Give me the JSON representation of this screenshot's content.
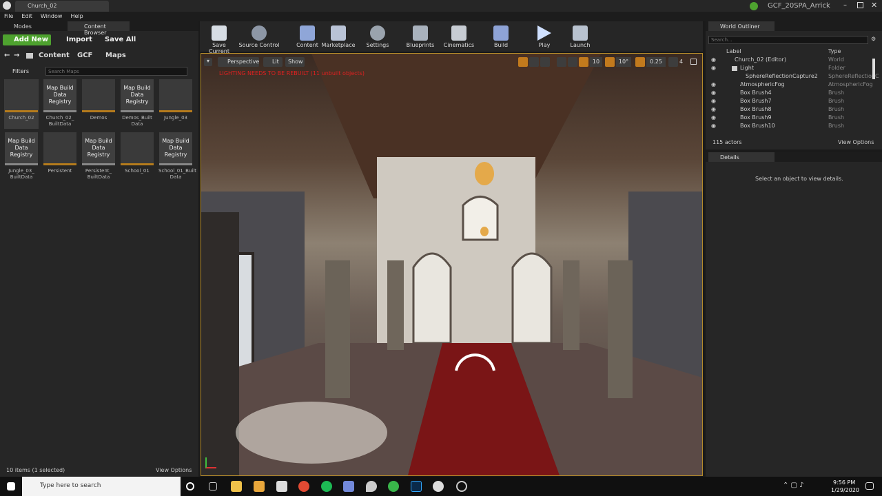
{
  "window": {
    "doc_tab": "Church_02",
    "project": "GCF_20SPA_Arrick"
  },
  "menu": [
    "File",
    "Edit",
    "Window",
    "Help"
  ],
  "left_tabs": {
    "modes": "Modes",
    "content_browser": "Content Browser"
  },
  "cb_toolbar": {
    "add_new": "Add New",
    "import": "Import",
    "save_all": "Save All"
  },
  "breadcrumb": [
    "Content",
    "GCF",
    "Maps"
  ],
  "filters": {
    "label": "Filters",
    "search_placeholder": "Search Maps"
  },
  "assets": [
    {
      "name": "Church_02",
      "kind": "map"
    },
    {
      "name": "Church_02_ BuiltData",
      "kind": "registry"
    },
    {
      "name": "Demos",
      "kind": "map"
    },
    {
      "name": "Demos_Built Data",
      "kind": "registry"
    },
    {
      "name": "Jungle_03",
      "kind": "map"
    },
    {
      "name": "Jungle_03_ BuiltData",
      "kind": "registry"
    },
    {
      "name": "Persistent",
      "kind": "map"
    },
    {
      "name": "Persistent_ BuiltData",
      "kind": "registry"
    },
    {
      "name": "School_01",
      "kind": "map"
    },
    {
      "name": "School_01_Built Data",
      "kind": "registry"
    }
  ],
  "registry_label": "Map Build Data Registry",
  "cb_status": {
    "count": "10 items (1 selected)",
    "view_options": "View Options"
  },
  "toolbar": [
    {
      "label": "Save Current",
      "icon": "save-icon"
    },
    {
      "label": "Source Control",
      "icon": "source-control-icon"
    },
    {
      "label": "Content",
      "icon": "content-icon"
    },
    {
      "label": "Marketplace",
      "icon": "marketplace-icon"
    },
    {
      "label": "Settings",
      "icon": "settings-icon"
    },
    {
      "label": "Blueprints",
      "icon": "blueprints-icon"
    },
    {
      "label": "Cinematics",
      "icon": "cinematics-icon"
    },
    {
      "label": "Build",
      "icon": "build-icon"
    },
    {
      "label": "Play",
      "icon": "play-icon"
    },
    {
      "label": "Launch",
      "icon": "launch-icon"
    }
  ],
  "viewport": {
    "perspective": "Perspective",
    "lit": "Lit",
    "show": "Show",
    "warning": "LIGHTING NEEDS TO BE REBUILT (11 unbuilt objects)",
    "grid_snap": "10",
    "rot_snap": "10°",
    "scale_snap": "0.25",
    "cam_speed": "4"
  },
  "outliner": {
    "tab": "World Outliner",
    "search_placeholder": "Search...",
    "col_label": "Label",
    "col_type": "Type",
    "rows": [
      {
        "label": "Church_02 (Editor)",
        "type": "World"
      },
      {
        "label": "Light",
        "type": "Folder"
      },
      {
        "label": "SphereReflectionCapture2",
        "type": "SphereReflectionC"
      },
      {
        "label": "AtmosphericFog",
        "type": "AtmosphericFog"
      },
      {
        "label": "Box Brush4",
        "type": "Brush"
      },
      {
        "label": "Box Brush7",
        "type": "Brush"
      },
      {
        "label": "Box Brush8",
        "type": "Brush"
      },
      {
        "label": "Box Brush9",
        "type": "Brush"
      },
      {
        "label": "Box Brush10",
        "type": "Brush"
      }
    ],
    "actors": "115 actors",
    "view_options": "View Options"
  },
  "details": {
    "tab": "Details",
    "empty": "Select an object to view details."
  },
  "taskbar": {
    "search": "Type here to search",
    "time": "9:56 PM",
    "date": "1/29/2020"
  },
  "colors": {
    "accent_green": "#4ea22f",
    "warning_red": "#e02020",
    "thumb_orange": "#b57b1c"
  }
}
